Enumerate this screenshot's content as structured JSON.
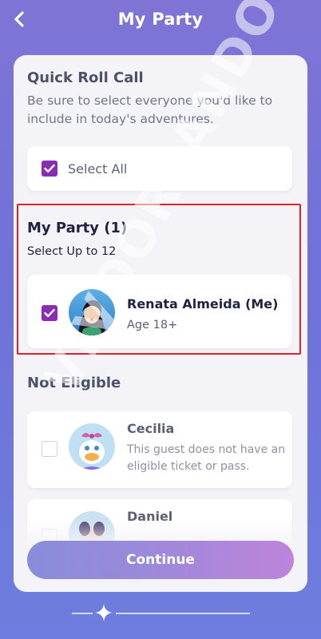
{
  "header": {
    "title": "My Party",
    "back_icon": "chevron-left-icon"
  },
  "quick_roll_call": {
    "title": "Quick Roll Call",
    "description": "Be sure to select everyone you'd like to include in today's adventures.",
    "select_all_label": "Select All",
    "select_all_checked": true
  },
  "my_party": {
    "title": "My Party (1)",
    "subtitle": "Select Up to 12",
    "members": [
      {
        "name": "Renata Almeida (Me)",
        "detail": "Age 18+",
        "checked": true,
        "avatar_icon": "character-avatar-icon"
      }
    ]
  },
  "not_eligible": {
    "title": "Not Eligible",
    "members": [
      {
        "name": "Cecilia",
        "detail": "This guest does not have an eligible ticket or pass.",
        "checked": false,
        "avatar_icon": "daisy-duck-avatar-icon"
      },
      {
        "name": "Daniel",
        "detail": "",
        "checked": false,
        "avatar_icon": "character-avatar-icon"
      }
    ]
  },
  "continue_label": "Continue",
  "watermark_text": "VIVOORLANDO.COM",
  "colors": {
    "accent": "#8a2db5",
    "highlight": "#e0202a",
    "title": "#1f2340"
  }
}
